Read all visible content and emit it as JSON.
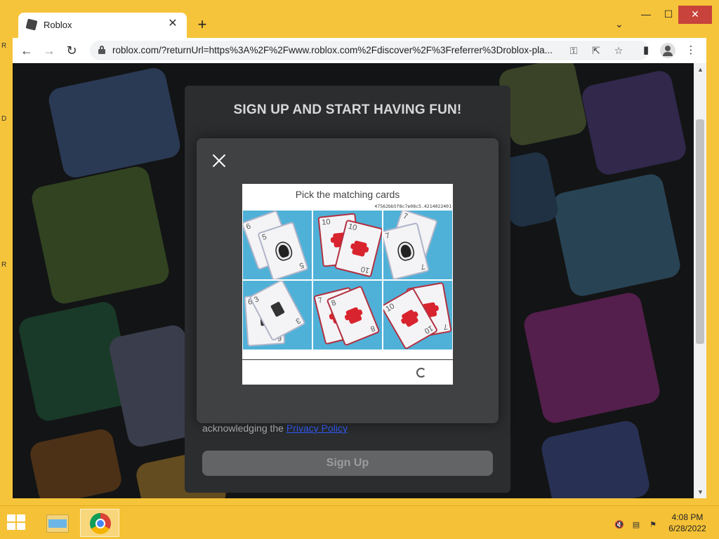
{
  "browser": {
    "tab_title": "Roblox",
    "tab_close": "✕",
    "new_tab": "+",
    "tab_search": "⌄",
    "window_min": "—",
    "window_max": "☐",
    "window_close": "✕",
    "nav_back": "←",
    "nav_forward": "→",
    "nav_reload": "↻",
    "url": "roblox.com/?returnUrl=https%3A%2F%2Fwww.roblox.com%2Fdiscover%2F%3Freferrer%3Droblox-pla...",
    "icons": {
      "key": "⚿",
      "share": "⇱",
      "star": "☆",
      "side_panel": "▮",
      "menu": "⋮"
    }
  },
  "desktop_edge": [
    "R",
    "D",
    "R"
  ],
  "signup": {
    "title": "SIGN UP AND START HAVING FUN!",
    "ack_prefix": "acknowledging the ",
    "privacy_link": "Privacy Policy",
    "button": "Sign Up"
  },
  "captcha": {
    "prompt": "Pick the matching cards",
    "hash": "47562bb5f8c7e08c5.4214022401",
    "cells": [
      {
        "cards": [
          {
            "n": "6",
            "suit": "dark"
          },
          {
            "n": "5",
            "suit": "spade"
          }
        ]
      },
      {
        "cards": [
          {
            "n": "10",
            "suit": "red"
          },
          {
            "n": "10",
            "suit": "red"
          }
        ]
      },
      {
        "cards": [
          {
            "n": "7",
            "suit": "spade"
          },
          {
            "n": "7",
            "suit": "spade"
          }
        ]
      },
      {
        "cards": [
          {
            "n": "6",
            "suit": "dark"
          },
          {
            "n": "3",
            "suit": "dark"
          }
        ]
      },
      {
        "cards": [
          {
            "n": "7",
            "suit": "red"
          },
          {
            "n": "8",
            "suit": "red"
          }
        ]
      },
      {
        "cards": [
          {
            "n": "7",
            "suit": "red"
          },
          {
            "n": "10",
            "suit": "red"
          }
        ]
      }
    ]
  },
  "taskbar": {
    "time": "4:08 PM",
    "date": "6/28/2022",
    "tray": {
      "volume": "🔇",
      "network": "▤",
      "flag": "⚑"
    }
  },
  "colors": {
    "accent_link": "#335fff",
    "window_frame": "#f6c43a",
    "close_button": "#c7433b"
  }
}
